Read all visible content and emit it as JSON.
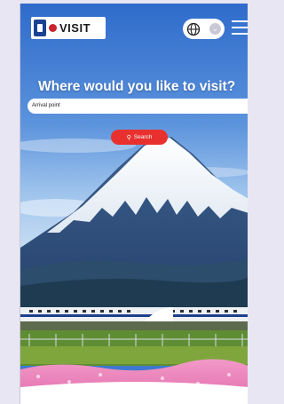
{
  "header": {
    "logo_text": "VISIT",
    "logo_icon": "japan-flag-icon",
    "language_icon": "globe-icon",
    "language_caret_icon": "chevron-down-icon",
    "menu_icon": "hamburger-menu-icon"
  },
  "hero": {
    "headline": "Where would you like to visit?",
    "search_input": {
      "value": "Arrival point"
    },
    "search_button": {
      "label": "Search",
      "icon": "search-icon"
    }
  },
  "colors": {
    "accent": "#e8312f",
    "page_background": "#e8e6f3",
    "brand_blue": "#1b4194"
  }
}
